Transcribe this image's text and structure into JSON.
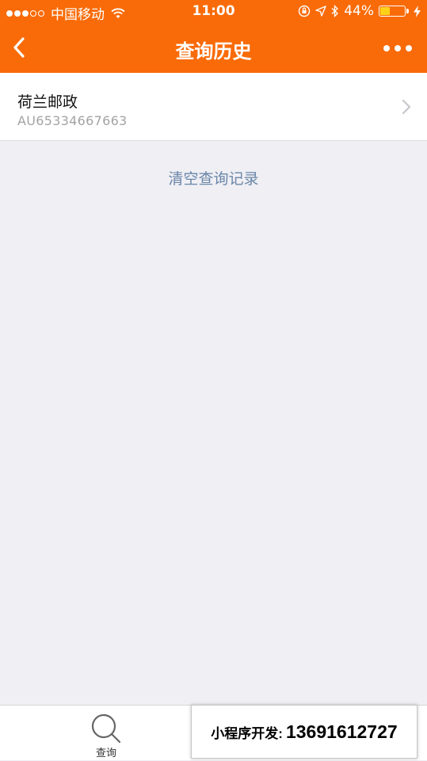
{
  "status_bar": {
    "carrier": "中国移动",
    "time": "11:00",
    "battery_percent": "44%",
    "battery_level": 0.44,
    "signal_bars": 3,
    "signal_total": 5
  },
  "nav": {
    "title": "查询历史",
    "back_icon": "chevron-left-icon",
    "more_icon": "more-dots-icon"
  },
  "history": {
    "items": [
      {
        "carrier": "荷兰邮政",
        "tracking_number": "AU65334667663"
      }
    ],
    "clear_label": "清空查询记录"
  },
  "tab_bar": {
    "tabs": [
      {
        "label": "查询",
        "icon": "search-icon"
      }
    ]
  },
  "ad": {
    "label": "小程序开发:",
    "phone": "13691612727"
  },
  "colors": {
    "accent": "#f96b08",
    "background": "#efeff4",
    "link": "#6b86a8",
    "muted_text": "#a3a3a3"
  }
}
